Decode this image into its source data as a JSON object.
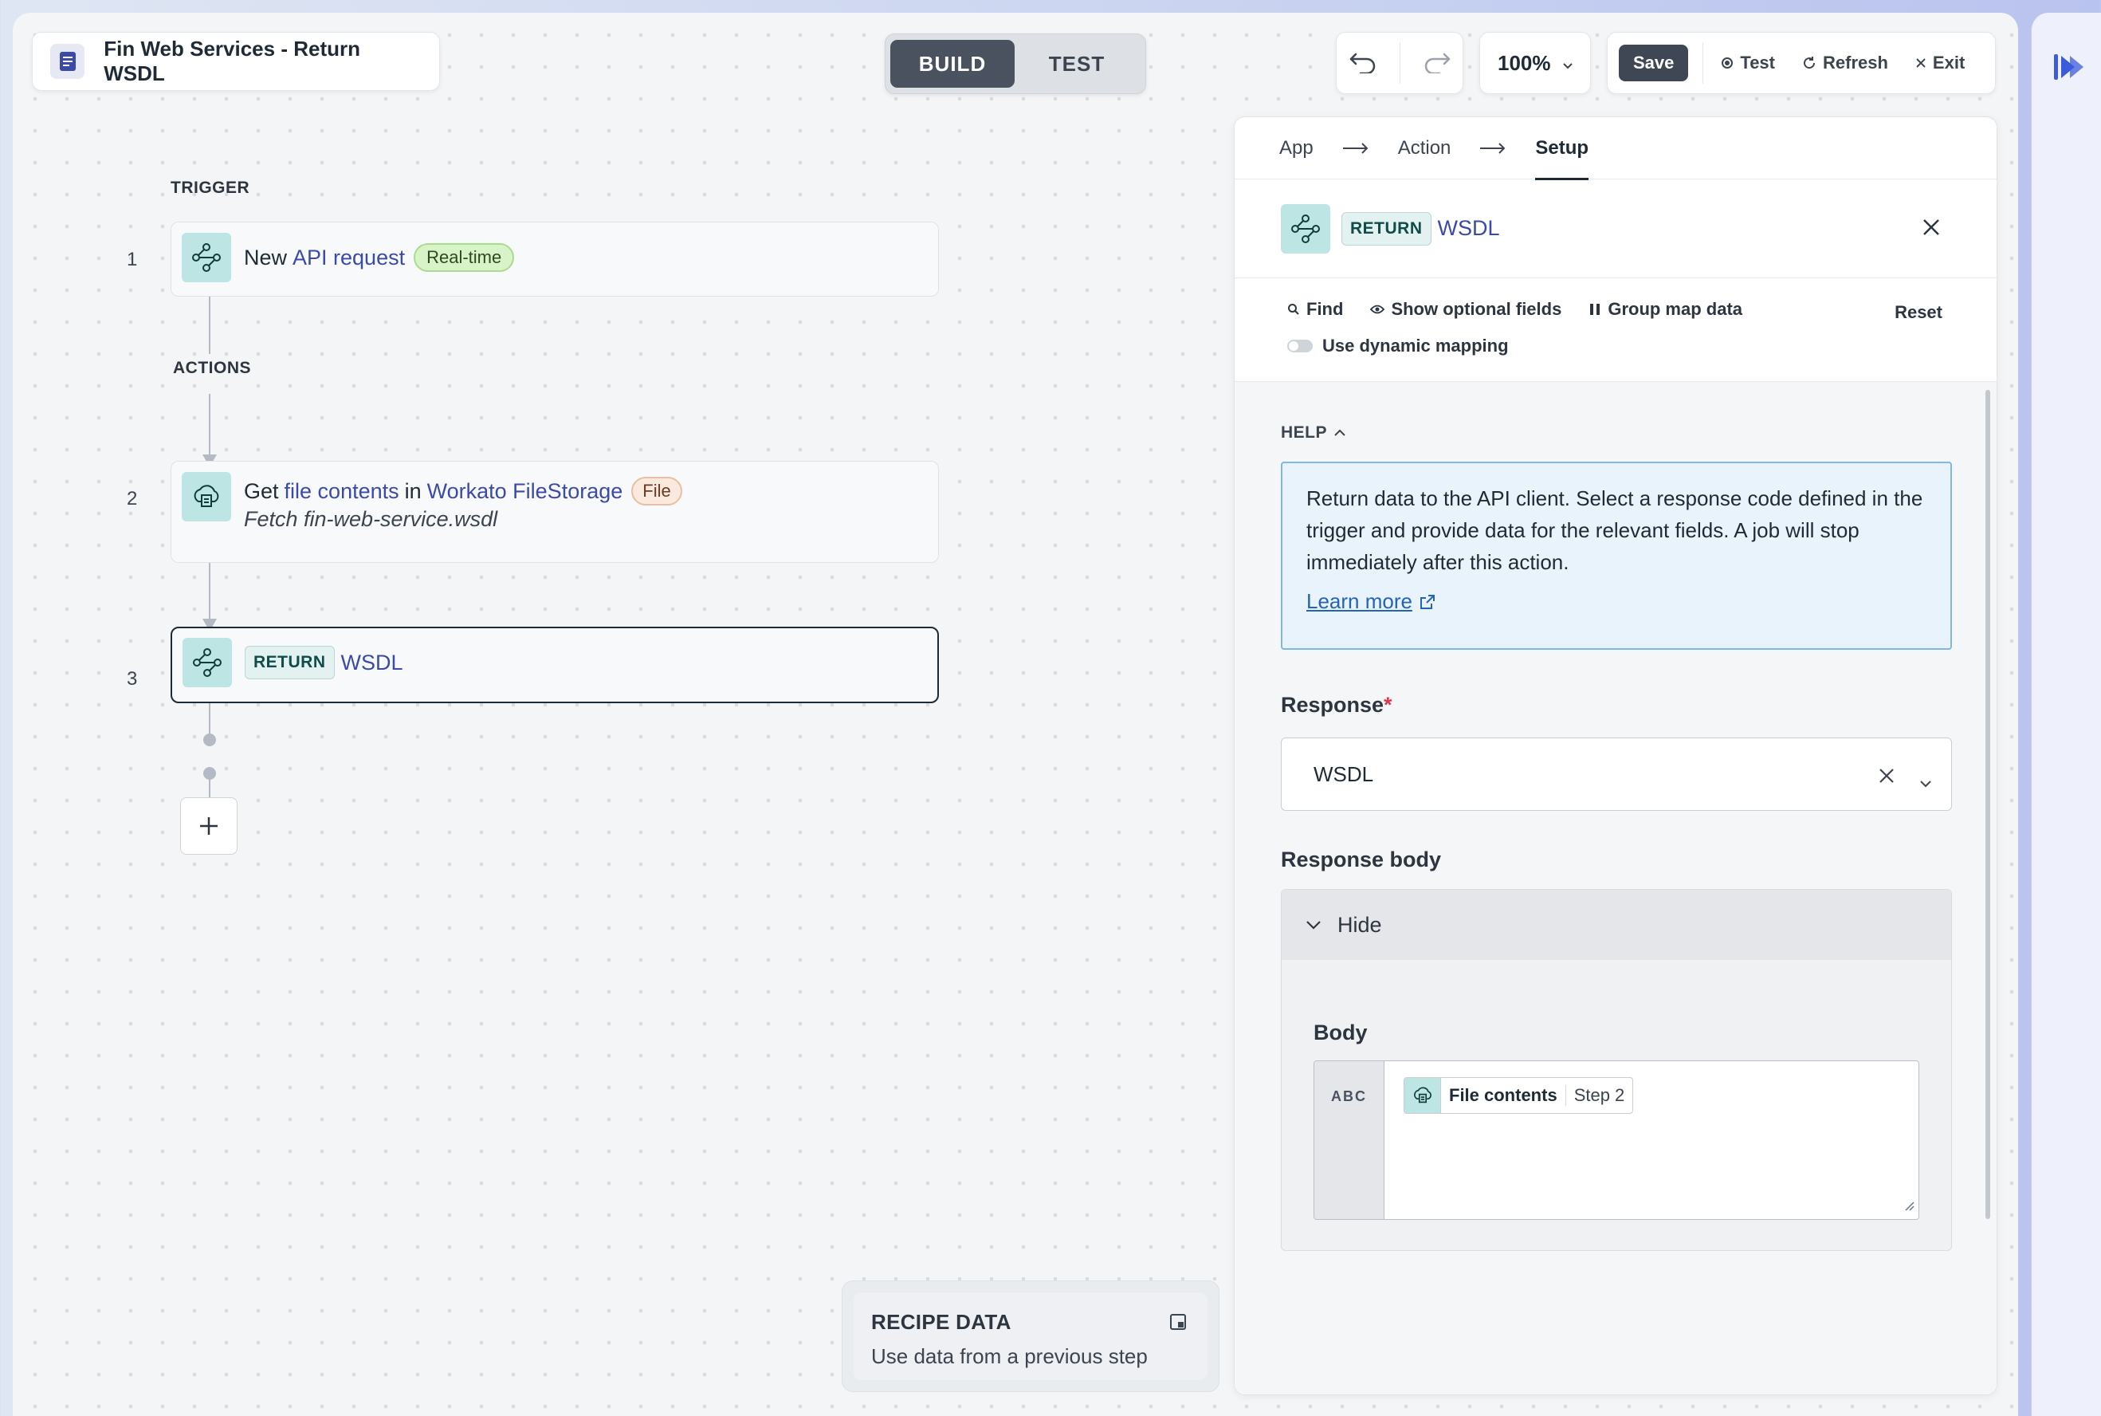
{
  "header": {
    "recipe_title": "Fin Web Services - Return WSDL",
    "mode_build": "BUILD",
    "mode_test": "TEST",
    "zoom": "100%",
    "save_label": "Save",
    "test_label": "Test",
    "refresh_label": "Refresh",
    "exit_label": "Exit"
  },
  "flow": {
    "trigger_label": "TRIGGER",
    "actions_label": "ACTIONS",
    "steps": [
      {
        "number": "1",
        "verb": "New",
        "object": "API request",
        "badge": "Real-time"
      },
      {
        "number": "2",
        "verb": "Get",
        "object": "file contents",
        "connector_word": "in",
        "app": "Workato FileStorage",
        "badge": "File",
        "subtitle": "Fetch fin-web-service.wsdl"
      },
      {
        "number": "3",
        "tag": "RETURN",
        "object": "WSDL"
      }
    ]
  },
  "recipe_data": {
    "title": "RECIPE DATA",
    "subtitle": "Use data from a previous step"
  },
  "panel": {
    "crumbs": [
      "App",
      "Action",
      "Setup"
    ],
    "head_tag": "RETURN",
    "head_title": "WSDL",
    "tools": {
      "find": "Find",
      "optional": "Show optional fields",
      "group": "Group map data",
      "reset": "Reset",
      "dynamic": "Use dynamic mapping"
    },
    "help": {
      "label": "HELP",
      "text": "Return data to the API client. Select a response code defined in the trigger and provide data for the relevant fields. A job will stop immediately after this action.",
      "learn_more": "Learn more"
    },
    "response": {
      "label": "Response",
      "required_mark": "*",
      "value": "WSDL"
    },
    "response_body": {
      "label": "Response body",
      "toggle": "Hide",
      "body_label": "Body",
      "type_tag": "ABC",
      "pill_name": "File contents",
      "pill_step": "Step 2"
    }
  },
  "colors": {
    "accent_link": "#3b4aa8",
    "step_icon_bg": "#bde5e3",
    "brand_rail": "#3b5bdb"
  }
}
